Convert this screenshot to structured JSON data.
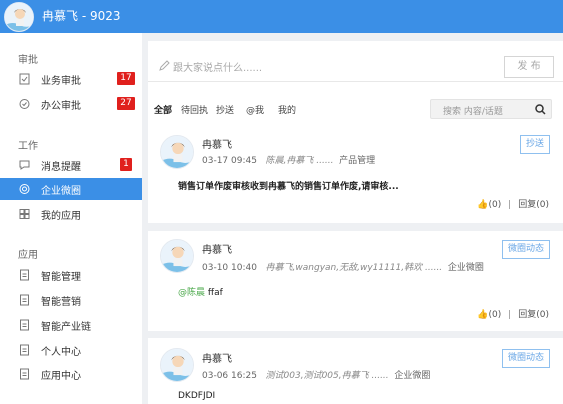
{
  "user": {
    "name": "冉慕飞 - 9023"
  },
  "sidebar": {
    "sections": [
      {
        "title": "审批"
      },
      {
        "title": "工作"
      },
      {
        "title": "应用"
      }
    ],
    "items": [
      {
        "label": "业务审批",
        "badge": "17",
        "icon": "document-approve-icon"
      },
      {
        "label": "办公审批",
        "badge": "27",
        "icon": "check-circle-icon"
      },
      {
        "label": "消息提醒",
        "badge": "1",
        "icon": "message-icon"
      },
      {
        "label": "企业微圈",
        "badge": "",
        "icon": "target-icon"
      },
      {
        "label": "我的应用",
        "badge": "",
        "icon": "grid-icon"
      },
      {
        "label": "智能管理",
        "badge": "",
        "icon": "document-icon"
      },
      {
        "label": "智能营销",
        "badge": "",
        "icon": "document-icon"
      },
      {
        "label": "智能产业链",
        "badge": "",
        "icon": "document-icon"
      },
      {
        "label": "个人中心",
        "badge": "",
        "icon": "document-icon"
      },
      {
        "label": "应用中心",
        "badge": "",
        "icon": "document-icon"
      }
    ]
  },
  "composer": {
    "placeholder": "跟大家说点什么......",
    "publish_label": "发 布"
  },
  "tabs": [
    "全部",
    "待回执",
    "抄送",
    "@我",
    "我的"
  ],
  "search": {
    "placeholder": "搜索 内容/话题"
  },
  "posts": [
    {
      "author": "冉慕飞",
      "time": "03-17 09:45",
      "recipients": "陈晨,冉慕飞 ......",
      "group": "产品管理",
      "tag": "抄送",
      "body": "销售订单作废审核收到冉慕飞的销售订单作废,请审核...",
      "mention": "",
      "likes": "(0)",
      "reply": "回复(0)"
    },
    {
      "author": "冉慕飞",
      "time": "03-10 10:40",
      "recipients": "冉慕飞,wangyan,无敌,wy11111,韩欢 ......",
      "group": "企业微圈",
      "tag": "微圈动态",
      "body": "ffaf",
      "mention": "@陈晨",
      "likes": "(0)",
      "reply": "回复(0)"
    },
    {
      "author": "冉慕飞",
      "time": "03-06 16:25",
      "recipients": "测试003,测试005,冉慕飞 ......",
      "group": "企业微圈",
      "tag": "微圈动态",
      "body": "DKDFJDI",
      "mention": "",
      "likes": "",
      "reply": ""
    }
  ],
  "colors": {
    "accent": "#3b8fe6",
    "badge": "#e0201d",
    "mention": "#4aa84a"
  }
}
